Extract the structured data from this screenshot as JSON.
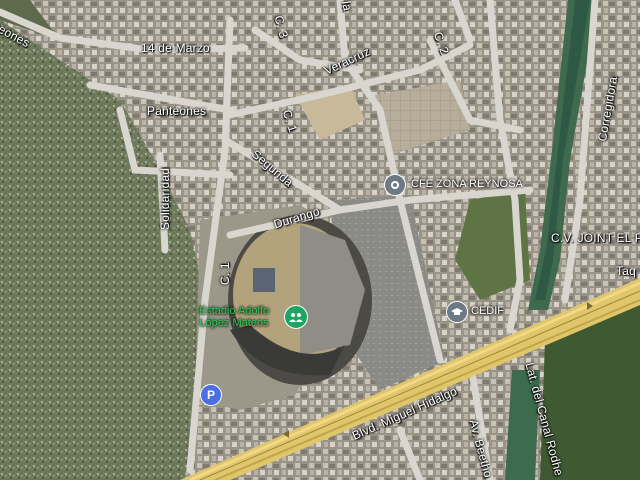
{
  "streets": {
    "marzo": "14 de Marzo",
    "panteones_left": "Panteones",
    "panteones": "Panteones",
    "veracruz": "Veracruz",
    "c3": "C. 3",
    "c2": "C. 2",
    "c1_top": "C. 1",
    "c1_left": "C. 1",
    "segunda": "Segunda",
    "durango": "Durango",
    "solidaridad": "Solidaridad",
    "corregidora": "Corregidora",
    "joint": "C.V. JOINT EL P",
    "taq": "Taq",
    "hidalgo": "Blvd. Miguel Hidalgo",
    "canal": "Lat. del Canal Rodhe",
    "beetho": "Av. Beetho",
    "la_top": "la"
  },
  "places": {
    "cfe": {
      "label": "CFE ZONA REYNOSA",
      "icon": "location-pin-icon"
    },
    "cedif": {
      "label": "CEDIF",
      "icon": "graduation-cap-icon"
    },
    "estadio": {
      "label_line1": "Estadio Adolfo",
      "label_line2": "López Mateos",
      "icon": "stadium-icon"
    },
    "parking": {
      "label": "P",
      "icon": "parking-icon"
    }
  },
  "colors": {
    "poi_gray": "#6b7a84",
    "stadium_green": "#1fa463",
    "parking_blue": "#4a6fe3",
    "highway": "#f2c94c"
  }
}
